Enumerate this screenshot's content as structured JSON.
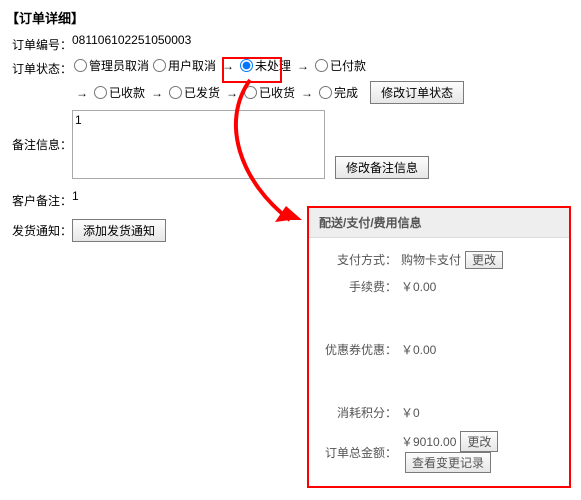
{
  "header": "【订单详细】",
  "orderNo": {
    "label": "订单编号：",
    "value": "081106102251050003"
  },
  "status": {
    "label": "订单状态：",
    "options": [
      "管理员取消",
      "用户取消",
      "未处理",
      "已付款",
      "已收款",
      "已发货",
      "已收货",
      "完成"
    ],
    "selectedIdx": 2,
    "arrow": "→",
    "btn": "修改订单状态"
  },
  "remark": {
    "label": "备注信息：",
    "value": "1",
    "btn": "修改备注信息"
  },
  "custRemark": {
    "label": "客户备注：",
    "value": "1"
  },
  "shipNotice": {
    "label": "发货通知：",
    "btn": "添加发货通知"
  },
  "panel": {
    "title": "配送/支付/费用信息",
    "payMethod": {
      "label": "支付方式：",
      "value": "购物卡支付",
      "btn": "更改"
    },
    "fee": {
      "label": "手续费：",
      "value": "￥0.00"
    },
    "coupon": {
      "label": "优惠券优惠：",
      "value": "￥0.00"
    },
    "points": {
      "label": "消耗积分：",
      "value": "￥0"
    },
    "total": {
      "label": "订单总金额：",
      "value": "￥9010.00",
      "btn1": "更改",
      "btn2": "查看变更记录"
    }
  }
}
